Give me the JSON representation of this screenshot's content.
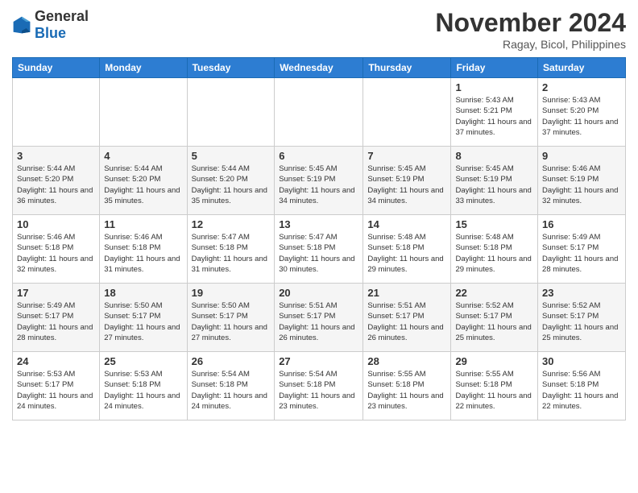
{
  "logo": {
    "text1": "General",
    "text2": "Blue"
  },
  "title": "November 2024",
  "location": "Ragay, Bicol, Philippines",
  "weekdays": [
    "Sunday",
    "Monday",
    "Tuesday",
    "Wednesday",
    "Thursday",
    "Friday",
    "Saturday"
  ],
  "weeks": [
    [
      {
        "day": "",
        "info": ""
      },
      {
        "day": "",
        "info": ""
      },
      {
        "day": "",
        "info": ""
      },
      {
        "day": "",
        "info": ""
      },
      {
        "day": "",
        "info": ""
      },
      {
        "day": "1",
        "info": "Sunrise: 5:43 AM\nSunset: 5:21 PM\nDaylight: 11 hours and 37 minutes."
      },
      {
        "day": "2",
        "info": "Sunrise: 5:43 AM\nSunset: 5:20 PM\nDaylight: 11 hours and 37 minutes."
      }
    ],
    [
      {
        "day": "3",
        "info": "Sunrise: 5:44 AM\nSunset: 5:20 PM\nDaylight: 11 hours and 36 minutes."
      },
      {
        "day": "4",
        "info": "Sunrise: 5:44 AM\nSunset: 5:20 PM\nDaylight: 11 hours and 35 minutes."
      },
      {
        "day": "5",
        "info": "Sunrise: 5:44 AM\nSunset: 5:20 PM\nDaylight: 11 hours and 35 minutes."
      },
      {
        "day": "6",
        "info": "Sunrise: 5:45 AM\nSunset: 5:19 PM\nDaylight: 11 hours and 34 minutes."
      },
      {
        "day": "7",
        "info": "Sunrise: 5:45 AM\nSunset: 5:19 PM\nDaylight: 11 hours and 34 minutes."
      },
      {
        "day": "8",
        "info": "Sunrise: 5:45 AM\nSunset: 5:19 PM\nDaylight: 11 hours and 33 minutes."
      },
      {
        "day": "9",
        "info": "Sunrise: 5:46 AM\nSunset: 5:19 PM\nDaylight: 11 hours and 32 minutes."
      }
    ],
    [
      {
        "day": "10",
        "info": "Sunrise: 5:46 AM\nSunset: 5:18 PM\nDaylight: 11 hours and 32 minutes."
      },
      {
        "day": "11",
        "info": "Sunrise: 5:46 AM\nSunset: 5:18 PM\nDaylight: 11 hours and 31 minutes."
      },
      {
        "day": "12",
        "info": "Sunrise: 5:47 AM\nSunset: 5:18 PM\nDaylight: 11 hours and 31 minutes."
      },
      {
        "day": "13",
        "info": "Sunrise: 5:47 AM\nSunset: 5:18 PM\nDaylight: 11 hours and 30 minutes."
      },
      {
        "day": "14",
        "info": "Sunrise: 5:48 AM\nSunset: 5:18 PM\nDaylight: 11 hours and 29 minutes."
      },
      {
        "day": "15",
        "info": "Sunrise: 5:48 AM\nSunset: 5:18 PM\nDaylight: 11 hours and 29 minutes."
      },
      {
        "day": "16",
        "info": "Sunrise: 5:49 AM\nSunset: 5:17 PM\nDaylight: 11 hours and 28 minutes."
      }
    ],
    [
      {
        "day": "17",
        "info": "Sunrise: 5:49 AM\nSunset: 5:17 PM\nDaylight: 11 hours and 28 minutes."
      },
      {
        "day": "18",
        "info": "Sunrise: 5:50 AM\nSunset: 5:17 PM\nDaylight: 11 hours and 27 minutes."
      },
      {
        "day": "19",
        "info": "Sunrise: 5:50 AM\nSunset: 5:17 PM\nDaylight: 11 hours and 27 minutes."
      },
      {
        "day": "20",
        "info": "Sunrise: 5:51 AM\nSunset: 5:17 PM\nDaylight: 11 hours and 26 minutes."
      },
      {
        "day": "21",
        "info": "Sunrise: 5:51 AM\nSunset: 5:17 PM\nDaylight: 11 hours and 26 minutes."
      },
      {
        "day": "22",
        "info": "Sunrise: 5:52 AM\nSunset: 5:17 PM\nDaylight: 11 hours and 25 minutes."
      },
      {
        "day": "23",
        "info": "Sunrise: 5:52 AM\nSunset: 5:17 PM\nDaylight: 11 hours and 25 minutes."
      }
    ],
    [
      {
        "day": "24",
        "info": "Sunrise: 5:53 AM\nSunset: 5:17 PM\nDaylight: 11 hours and 24 minutes."
      },
      {
        "day": "25",
        "info": "Sunrise: 5:53 AM\nSunset: 5:18 PM\nDaylight: 11 hours and 24 minutes."
      },
      {
        "day": "26",
        "info": "Sunrise: 5:54 AM\nSunset: 5:18 PM\nDaylight: 11 hours and 24 minutes."
      },
      {
        "day": "27",
        "info": "Sunrise: 5:54 AM\nSunset: 5:18 PM\nDaylight: 11 hours and 23 minutes."
      },
      {
        "day": "28",
        "info": "Sunrise: 5:55 AM\nSunset: 5:18 PM\nDaylight: 11 hours and 23 minutes."
      },
      {
        "day": "29",
        "info": "Sunrise: 5:55 AM\nSunset: 5:18 PM\nDaylight: 11 hours and 22 minutes."
      },
      {
        "day": "30",
        "info": "Sunrise: 5:56 AM\nSunset: 5:18 PM\nDaylight: 11 hours and 22 minutes."
      }
    ]
  ]
}
